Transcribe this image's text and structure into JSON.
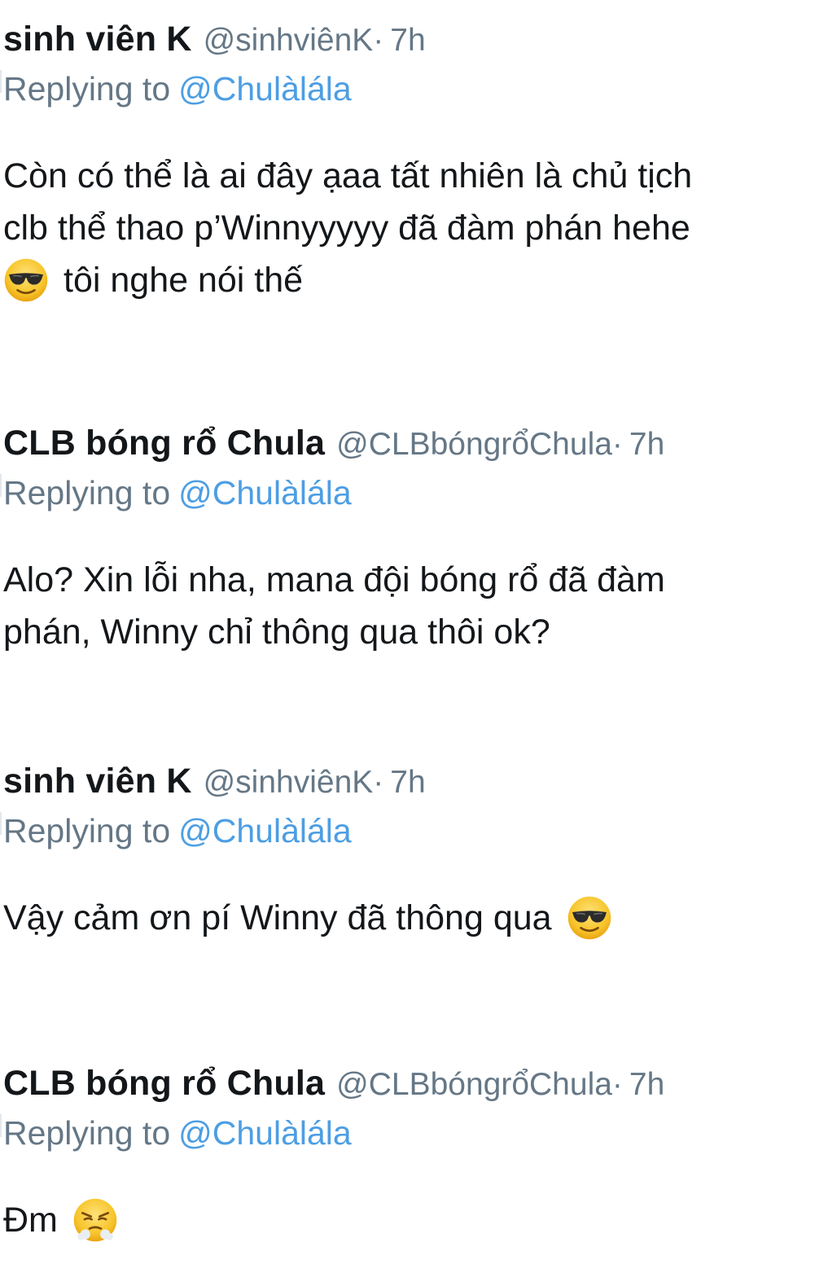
{
  "tweets": [
    {
      "name": "sinh viên K",
      "handle": "@sinhviênK",
      "dot": "·",
      "time": "7h",
      "replying_label": "Replying to",
      "replying_to": "@Chulàlála",
      "lines": [
        "Còn có thể là ai đây ạaa tất nhiên là chủ tịch",
        "clb thể thao p’Winnyyyyy đã đàm phán hehe",
        "tôi nghe nói thế"
      ],
      "emoji": [
        "smiling-face-with-sunglasses"
      ]
    },
    {
      "name": "CLB bóng rổ Chula",
      "handle": "@CLBbóngrổChula",
      "dot": "·",
      "time": "7h",
      "replying_label": "Replying to",
      "replying_to": "@Chulàlála",
      "lines": [
        "Alo? Xin lỗi nha, mana đội bóng rổ đã đàm",
        "phán, Winny chỉ thông qua thôi ok?"
      ]
    },
    {
      "name": "sinh viên K",
      "handle": "@sinhviênK",
      "dot": "·",
      "time": "7h",
      "replying_label": "Replying to",
      "replying_to": "@Chulàlála",
      "lines": [
        "Vậy cảm ơn pí Winny đã thông qua"
      ],
      "emoji": [
        "smiling-face-with-sunglasses"
      ]
    },
    {
      "name": "CLB bóng rổ Chula",
      "handle": "@CLBbóngrổChula",
      "dot": "·",
      "time": "7h",
      "replying_label": "Replying to",
      "replying_to": "@Chulàlála",
      "lines": [
        "Đm"
      ],
      "emoji": [
        "face-with-steam-from-nose"
      ]
    }
  ],
  "colors": {
    "name": "#14171a",
    "meta": "#657786",
    "link": "#4d9ee3",
    "emoji_face": "#f7c52b",
    "emoji_glasses": "#2b2b2b"
  }
}
